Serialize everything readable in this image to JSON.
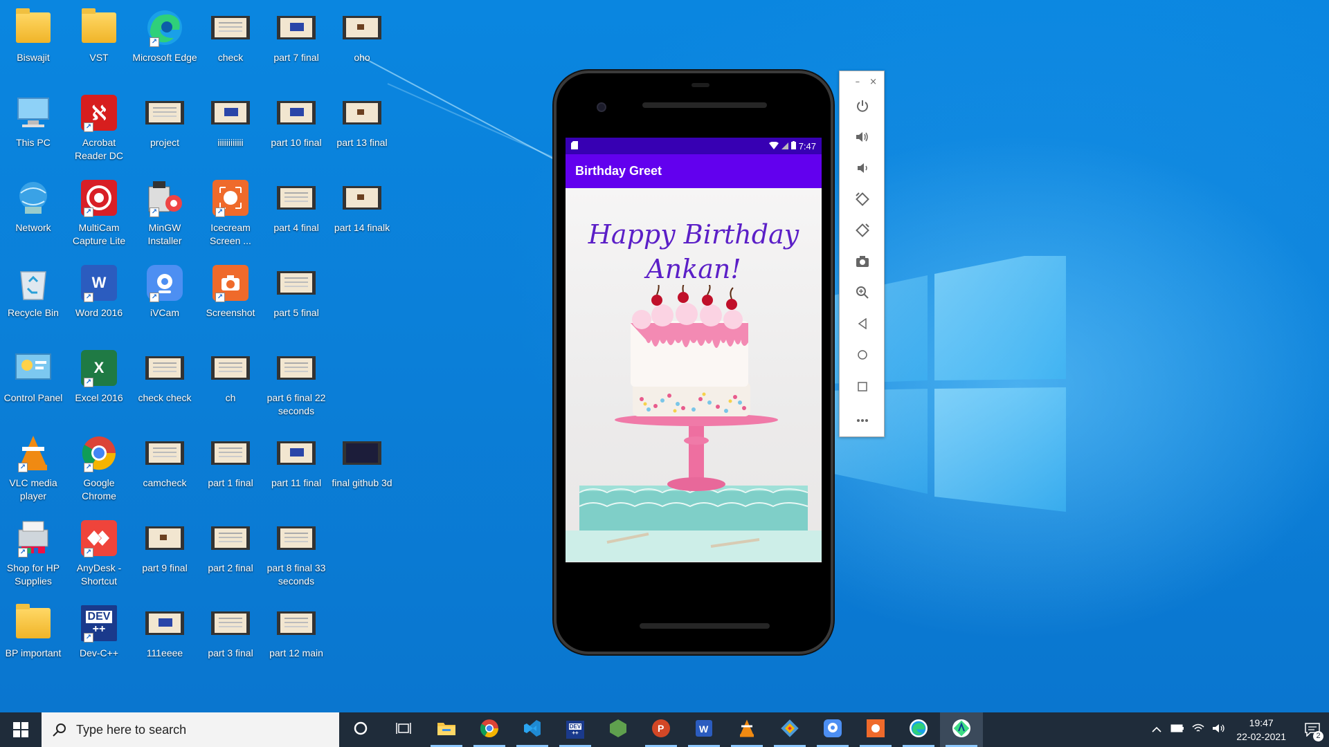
{
  "desktop_icons": [
    {
      "label": "Biswajit",
      "icon": "user-folder-icon"
    },
    {
      "label": "VST",
      "icon": "folder-icon"
    },
    {
      "label": "Microsoft Edge",
      "icon": "edge-icon"
    },
    {
      "label": "check",
      "icon": "video-file-icon"
    },
    {
      "label": "part 7 final",
      "icon": "video-file-icon"
    },
    {
      "label": "oho",
      "icon": "video-file-icon"
    },
    {
      "label": "This PC",
      "icon": "this-pc-icon"
    },
    {
      "label": "Acrobat Reader DC",
      "icon": "acrobat-icon"
    },
    {
      "label": "project",
      "icon": "video-file-icon"
    },
    {
      "label": "iiiiiiiiiiii",
      "icon": "video-file-icon"
    },
    {
      "label": "part 10 final",
      "icon": "video-file-icon"
    },
    {
      "label": "part 13 final",
      "icon": "video-file-icon"
    },
    {
      "label": "Network",
      "icon": "network-icon"
    },
    {
      "label": "MultiCam Capture Lite",
      "icon": "multicam-icon"
    },
    {
      "label": "MinGW Installer",
      "icon": "mingw-icon"
    },
    {
      "label": "Icecream Screen ...",
      "icon": "icecream-icon"
    },
    {
      "label": "part 4 final",
      "icon": "video-file-icon"
    },
    {
      "label": "part 14 finalk",
      "icon": "video-file-icon"
    },
    {
      "label": "Recycle Bin",
      "icon": "recycle-bin-icon"
    },
    {
      "label": "Word 2016",
      "icon": "word-icon"
    },
    {
      "label": "iVCam",
      "icon": "ivcam-icon"
    },
    {
      "label": "Screenshot",
      "icon": "screenshot-icon"
    },
    {
      "label": "part 5 final",
      "icon": "video-file-icon"
    },
    {
      "label": "Control Panel",
      "icon": "control-panel-icon"
    },
    {
      "label": "Excel 2016",
      "icon": "excel-icon"
    },
    {
      "label": "check check",
      "icon": "video-file-icon"
    },
    {
      "label": "ch",
      "icon": "video-file-icon"
    },
    {
      "label": "part 6 final 22 seconds",
      "icon": "video-file-icon"
    },
    {
      "label": "VLC media player",
      "icon": "vlc-icon"
    },
    {
      "label": "Google Chrome",
      "icon": "chrome-icon"
    },
    {
      "label": "camcheck",
      "icon": "video-file-icon"
    },
    {
      "label": "part 1 final",
      "icon": "video-file-icon"
    },
    {
      "label": "part 11 final",
      "icon": "video-file-icon"
    },
    {
      "label": "final github 3d",
      "icon": "video-file-icon"
    },
    {
      "label": "Shop for HP Supplies",
      "icon": "hp-icon"
    },
    {
      "label": "AnyDesk - Shortcut",
      "icon": "anydesk-icon"
    },
    {
      "label": "part 9 final",
      "icon": "video-file-icon"
    },
    {
      "label": "part 2 final",
      "icon": "video-file-icon"
    },
    {
      "label": "part 8 final 33 seconds",
      "icon": "video-file-icon"
    },
    {
      "label": "BP important",
      "icon": "folder-icon"
    },
    {
      "label": "Dev-C++",
      "icon": "devcpp-icon"
    },
    {
      "label": "111eeee",
      "icon": "video-file-icon"
    },
    {
      "label": "part 3 final",
      "icon": "video-file-icon"
    },
    {
      "label": "part 12 main",
      "icon": "video-file-icon"
    }
  ],
  "emulator": {
    "status_time": "7:47",
    "app_title": "Birthday Greet",
    "greeting_line1": "Happy Birthday",
    "greeting_line2": "Ankan!",
    "toolbar": {
      "minimize": "–",
      "close": "×",
      "buttons": [
        "power-icon",
        "volume-up-icon",
        "volume-down-icon",
        "rotate-left-icon",
        "rotate-right-icon",
        "camera-icon",
        "zoom-icon",
        "back-icon",
        "home-icon",
        "overview-icon",
        "more-icon"
      ],
      "more_label": "•••"
    }
  },
  "taskbar": {
    "search_placeholder": "Type here to search",
    "apps": [
      "cortana-icon",
      "task-view-icon",
      "file-explorer-icon",
      "chrome-icon",
      "vscode-icon",
      "devcpp-icon",
      "nodejs-icon",
      "powerpoint-icon",
      "word-icon",
      "vlc-icon",
      "git-icon",
      "ivcam-icon",
      "icecream-icon",
      "edge-icon",
      "android-studio-icon"
    ],
    "clock_time": "19:47",
    "clock_date": "22-02-2021",
    "notification_count": "2"
  },
  "colors": {
    "status_bar": "#3700b3",
    "app_bar": "#6200ee",
    "greeting_text": "#5b1fc7",
    "taskbar": "#1f2c3a"
  }
}
